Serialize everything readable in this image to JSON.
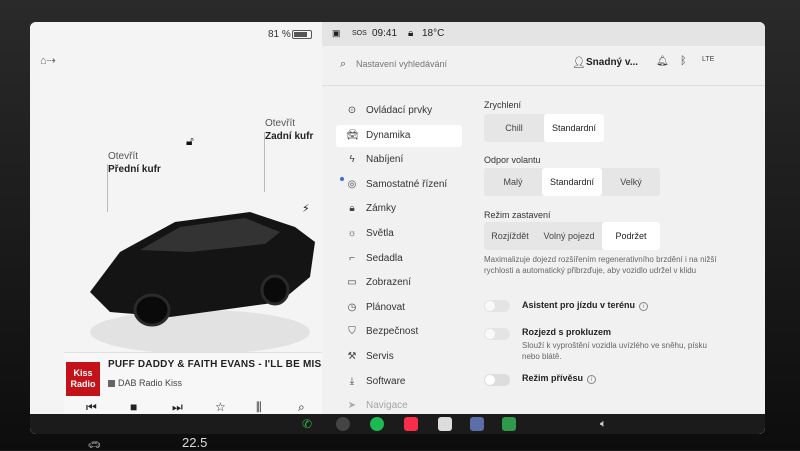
{
  "left_panel": {
    "battery_percent": "81 %",
    "battery_level": 0.81,
    "frunk": {
      "action": "Otevřít",
      "label": "Přední kufr"
    },
    "trunk": {
      "action": "Otevřít",
      "label": "Zadní kufr"
    },
    "icons": [
      "car-mode-icon",
      "unlock-icon",
      "charge-bolt-icon"
    ]
  },
  "media": {
    "album_text": "Kiss Radio",
    "track": "PUFF DADDY & FAITH EVANS - I'LL BE MISSING",
    "station": "DAB Radio Kiss",
    "controls": [
      "prev-icon",
      "stop-icon",
      "next-icon",
      "favorite-icon",
      "equalizer-icon",
      "search-icon"
    ]
  },
  "status_bar": {
    "sos": "SOS",
    "time": "09:41",
    "temperature": "18°C"
  },
  "search": {
    "placeholder": "Nastavení vyhledávání"
  },
  "profile": {
    "name": "Snadný v..."
  },
  "menu": {
    "items": [
      {
        "label": "Ovládací prvky",
        "icon": "toggle-icon"
      },
      {
        "label": "Dynamika",
        "icon": "car-icon",
        "active": true
      },
      {
        "label": "Nabíjení",
        "icon": "bolt-icon"
      },
      {
        "label": "Samostatné řízení",
        "icon": "steering-wheel-icon",
        "dot": true
      },
      {
        "label": "Zámky",
        "icon": "lock-icon"
      },
      {
        "label": "Světla",
        "icon": "light-icon"
      },
      {
        "label": "Sedadla",
        "icon": "seat-icon"
      },
      {
        "label": "Zobrazení",
        "icon": "display-icon"
      },
      {
        "label": "Plánovat",
        "icon": "clock-icon"
      },
      {
        "label": "Bezpečnost",
        "icon": "shield-icon"
      },
      {
        "label": "Servis",
        "icon": "wrench-icon"
      },
      {
        "label": "Software",
        "icon": "download-icon"
      },
      {
        "label": "Navigace",
        "icon": "navigation-icon"
      }
    ]
  },
  "dynamics": {
    "acceleration": {
      "label": "Zrychlení",
      "options": [
        "Chill",
        "Standardní"
      ],
      "selected": "Standardní"
    },
    "steering": {
      "label": "Odpor volantu",
      "options": [
        "Malý",
        "Standardní",
        "Velký"
      ],
      "selected": "Standardní"
    },
    "stopping": {
      "label": "Režim zastavení",
      "options": [
        "Rozjíždět",
        "Volný pojezd",
        "Podržet"
      ],
      "selected": "Podržet",
      "hint": "Maximalizuje dojezd rozšířením regenerativního brzdění i na nižší rychlosti a automatický přibrzďuje, aby vozidlo udržel v klidu"
    },
    "toggles": [
      {
        "label": "Asistent pro jízdu v terénu",
        "info": true,
        "enabled": false,
        "disabled": true
      },
      {
        "label": "Rozjezd s prokluzem",
        "hint": "Slouží k vyproštění vozidla uvízlého ve sněhu, písku nebo blátě.",
        "enabled": false,
        "disabled": true
      },
      {
        "label": "Režim přívěsu",
        "info": true,
        "enabled": false
      }
    ]
  },
  "bottom": {
    "temperature": "22.5"
  },
  "colors": {
    "accent": "#3e6ae1",
    "phone": "#2fb24c",
    "spotify": "#1db954",
    "music": "#fa2d48"
  }
}
